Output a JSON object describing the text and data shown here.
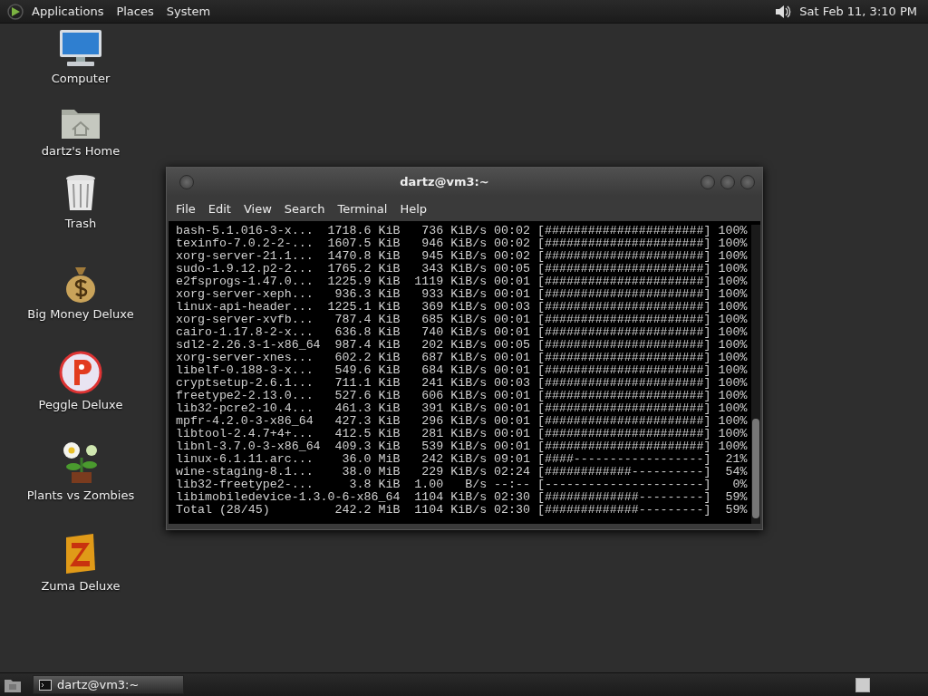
{
  "top_panel": {
    "menus": [
      "Applications",
      "Places",
      "System"
    ],
    "clock": "Sat Feb 11, 3:10 PM"
  },
  "desktop_icons": [
    {
      "kind": "computer",
      "label": "Computer"
    },
    {
      "kind": "home",
      "label": "dartz's Home"
    },
    {
      "kind": "trash",
      "label": "Trash"
    },
    {
      "kind": "money",
      "label": "Big Money Deluxe"
    },
    {
      "kind": "peggle",
      "label": "Peggle Deluxe"
    },
    {
      "kind": "plant",
      "label": "Plants vs Zombies"
    },
    {
      "kind": "zuma",
      "label": "Zuma Deluxe"
    }
  ],
  "terminal": {
    "title": "dartz@vm3:~",
    "menu": [
      "File",
      "Edit",
      "View",
      "Search",
      "Terminal",
      "Help"
    ],
    "lines": [
      "bash-5.1.016-3-x...  1718.6 KiB   736 KiB/s 00:02 [######################] 100%",
      "texinfo-7.0.2-2-...  1607.5 KiB   946 KiB/s 00:02 [######################] 100%",
      "xorg-server-21.1...  1470.8 KiB   945 KiB/s 00:02 [######################] 100%",
      "sudo-1.9.12.p2-2...  1765.2 KiB   343 KiB/s 00:05 [######################] 100%",
      "e2fsprogs-1.47.0...  1225.9 KiB  1119 KiB/s 00:01 [######################] 100%",
      "xorg-server-xeph...   936.3 KiB   933 KiB/s 00:01 [######################] 100%",
      "linux-api-header...  1225.1 KiB   369 KiB/s 00:03 [######################] 100%",
      "xorg-server-xvfb...   787.4 KiB   685 KiB/s 00:01 [######################] 100%",
      "cairo-1.17.8-2-x...   636.8 KiB   740 KiB/s 00:01 [######################] 100%",
      "sdl2-2.26.3-1-x86_64  987.4 KiB   202 KiB/s 00:05 [######################] 100%",
      "xorg-server-xnes...   602.2 KiB   687 KiB/s 00:01 [######################] 100%",
      "libelf-0.188-3-x...   549.6 KiB   684 KiB/s 00:01 [######################] 100%",
      "cryptsetup-2.6.1...   711.1 KiB   241 KiB/s 00:03 [######################] 100%",
      "freetype2-2.13.0...   527.6 KiB   606 KiB/s 00:01 [######################] 100%",
      "lib32-pcre2-10.4...   461.3 KiB   391 KiB/s 00:01 [######################] 100%",
      "mpfr-4.2.0-3-x86_64   427.3 KiB   296 KiB/s 00:01 [######################] 100%",
      "libtool-2.4.7+4+...   412.5 KiB   281 KiB/s 00:01 [######################] 100%",
      "libnl-3.7.0-3-x86_64  409.3 KiB   539 KiB/s 00:01 [######################] 100%",
      "linux-6.1.11.arc...    36.0 MiB   242 KiB/s 09:01 [####------------------]  21%",
      "wine-staging-8.1...    38.0 MiB   229 KiB/s 02:24 [############----------]  54%",
      "lib32-freetype2-...     3.8 KiB  1.00   B/s --:-- [----------------------]   0%",
      "libimobiledevice-1.3.0-6-x86_64  1104 KiB/s 02:30 [#############---------]  59%",
      "Total (28/45)         242.2 MiB  1104 KiB/s 02:30 [#############---------]  59%"
    ]
  },
  "taskbar": {
    "tasks": [
      {
        "label": "dartz@vm3:~"
      }
    ]
  }
}
